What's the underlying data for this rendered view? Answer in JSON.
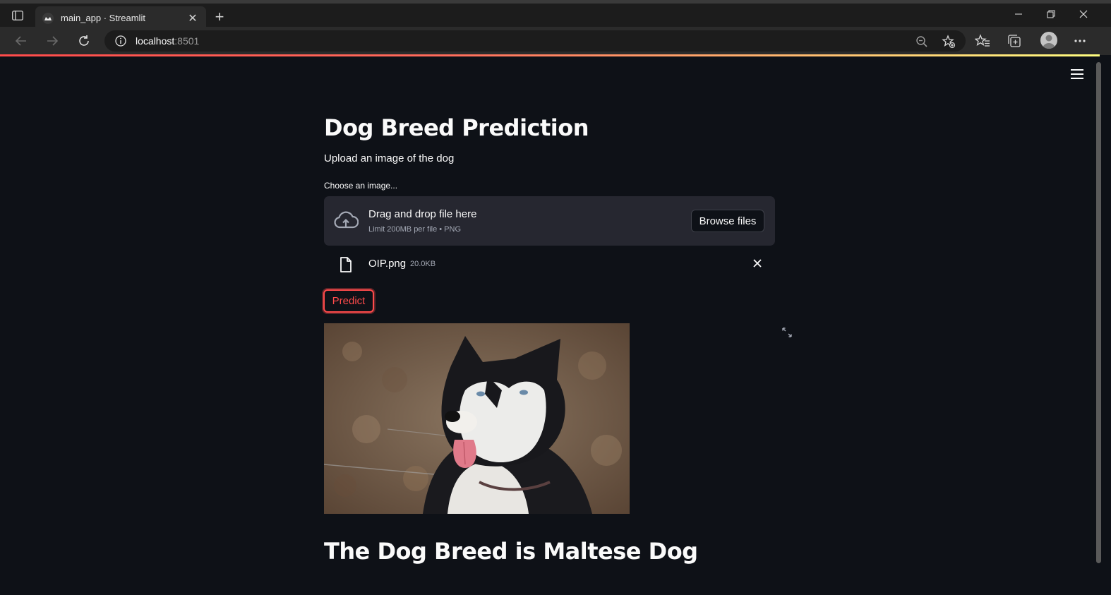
{
  "browser": {
    "tab_title": "main_app · Streamlit",
    "address_host": "localhost",
    "address_port": ":8501",
    "icons": [
      "sidebar-toggle-icon",
      "streamlit-favicon",
      "close-icon",
      "plus-icon",
      "minimize-icon",
      "restore-icon",
      "close-window-icon",
      "back-icon",
      "forward-icon",
      "refresh-icon",
      "info-icon",
      "zoom-out-icon",
      "add-favorite-icon",
      "favorites-icon",
      "collections-icon",
      "profile-avatar",
      "more-icon"
    ]
  },
  "app": {
    "title": "Dog Breed Prediction",
    "subtitle": "Upload an image of the dog",
    "uploader_label": "Choose an image...",
    "drop_text": "Drag and drop file here",
    "drop_limit": "Limit 200MB per file • PNG",
    "browse_label": "Browse files",
    "file_name": "OIP.png",
    "file_size": "20.0KB",
    "predict_label": "Predict",
    "result_text": "The Dog Breed is Maltese Dog",
    "accent_color": "#ff4b4b",
    "background_color": "#0e1117",
    "secondary_bg_color": "#262730"
  }
}
